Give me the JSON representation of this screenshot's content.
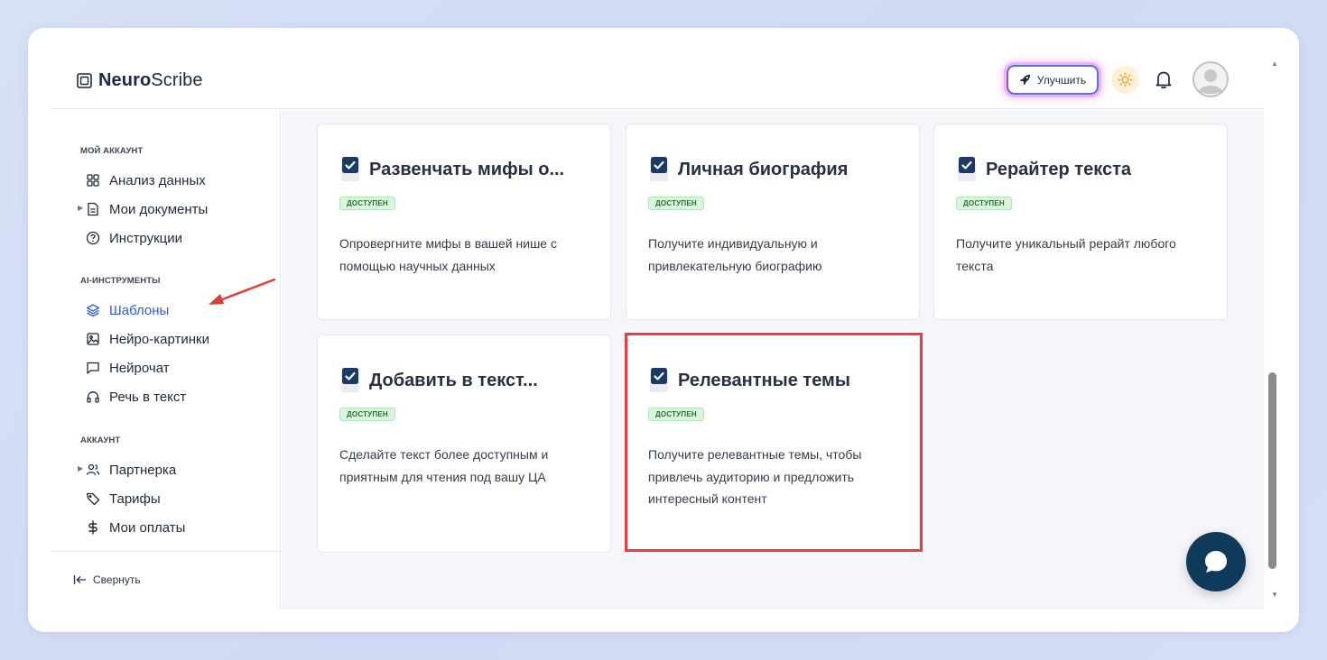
{
  "app": {
    "logo_bold": "Neuro",
    "logo_rest": "Scribe"
  },
  "header": {
    "upgrade_label": "Улучшить",
    "icons": [
      "rocket-icon",
      "sun-icon",
      "bell-icon",
      "avatar"
    ]
  },
  "sidebar": {
    "sections": [
      {
        "title": "МОЙ АККАУНТ",
        "items": [
          {
            "label": "Анализ данных",
            "icon": "grid-icon"
          },
          {
            "label": "Мои документы",
            "icon": "document-icon",
            "expandable": true
          },
          {
            "label": "Инструкции",
            "icon": "help-circle-icon"
          }
        ]
      },
      {
        "title": "AI-ИНСТРУМЕНТЫ",
        "items": [
          {
            "label": "Шаблоны",
            "icon": "layers-icon",
            "active": true
          },
          {
            "label": "Нейро-картинки",
            "icon": "image-icon"
          },
          {
            "label": "Нейрочат",
            "icon": "chat-icon"
          },
          {
            "label": "Речь в текст",
            "icon": "headphones-icon"
          }
        ]
      },
      {
        "title": "АККАУНТ",
        "items": [
          {
            "label": "Партнерка",
            "icon": "users-icon",
            "expandable": true
          },
          {
            "label": "Тарифы",
            "icon": "tag-icon"
          },
          {
            "label": "Мои оплаты",
            "icon": "dollar-icon"
          }
        ]
      }
    ],
    "collapse_label": "Свернуть"
  },
  "cards": [
    {
      "title": "Развенчать мифы о...",
      "badge": "ДОСТУПЕН",
      "description": "Опровергните мифы в вашей нише с помощью научных данных"
    },
    {
      "title": "Личная биография",
      "badge": "ДОСТУПЕН",
      "description": "Получите индивидуальную и привлекательную биографию"
    },
    {
      "title": "Рерайтер текста",
      "badge": "ДОСТУПЕН",
      "description": "Получите уникальный рерайт любого текста"
    },
    {
      "title": "Добавить в текст...",
      "badge": "ДОСТУПЕН",
      "description": "Сделайте текст более доступным и приятным для чтения под вашу ЦА"
    },
    {
      "title": "Релевантные темы",
      "badge": "ДОСТУПЕН",
      "description": "Получите релевантные темы, чтобы привлечь аудиторию и предложить интересный контент",
      "highlighted": true
    }
  ],
  "colors": {
    "accent": "#2f5dd8",
    "badge_bg": "#d9f5dc",
    "highlight": "#ea3d43",
    "chat_button": "#0f3a5a"
  }
}
